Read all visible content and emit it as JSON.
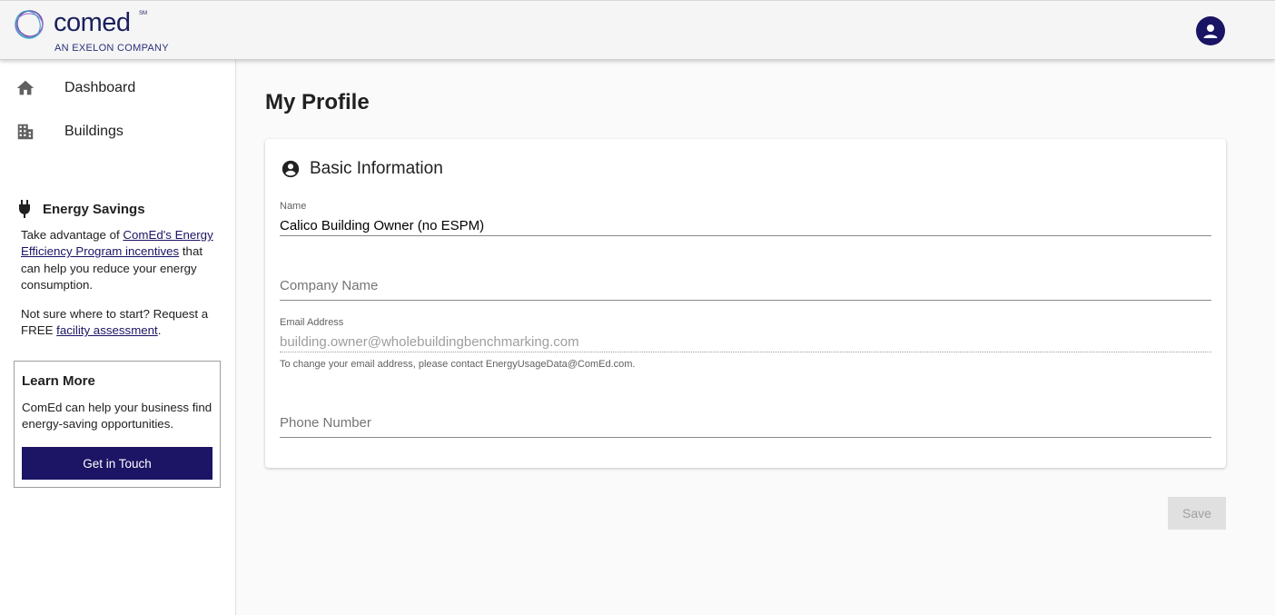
{
  "brand": {
    "name": "comed",
    "service_mark": "SM",
    "tagline": "AN EXELON COMPANY",
    "logo_icon": "comed-ring-logo"
  },
  "header": {
    "avatar_icon": "account-circle-icon"
  },
  "sidebar": {
    "nav": [
      {
        "label": "Dashboard",
        "icon": "home-icon"
      },
      {
        "label": "Buildings",
        "icon": "building-icon"
      }
    ],
    "energy_savings": {
      "title": "Energy Savings",
      "icon": "plug-icon",
      "p1_before": "Take advantage of ",
      "p1_link": "ComEd's Energy Efficiency Program incentives",
      "p1_after": " that can help you reduce your energy consumption.",
      "p2_before": "Not sure where to start? Request a FREE ",
      "p2_link": "facility assessment",
      "p2_after": "."
    },
    "learn_more": {
      "title": "Learn More",
      "text": "ComEd can help your business find energy-saving opportunities.",
      "button": "Get in Touch"
    }
  },
  "main": {
    "title": "My Profile",
    "card": {
      "title": "Basic Information",
      "icon": "account-circle-icon",
      "fields": {
        "name": {
          "label": "Name",
          "value": "Calico Building Owner (no ESPM)"
        },
        "company": {
          "placeholder": "Company Name"
        },
        "email": {
          "label": "Email Address",
          "value": "building.owner@wholebuildingbenchmarking.com",
          "help": "To change your email address, please contact EnergyUsageData@ComEd.com."
        },
        "phone": {
          "placeholder": "Phone Number"
        }
      }
    },
    "save_label": "Save"
  },
  "colors": {
    "brand_navy": "#1c1464",
    "header_bg": "#f5f5f5",
    "page_bg": "#fafafa"
  }
}
